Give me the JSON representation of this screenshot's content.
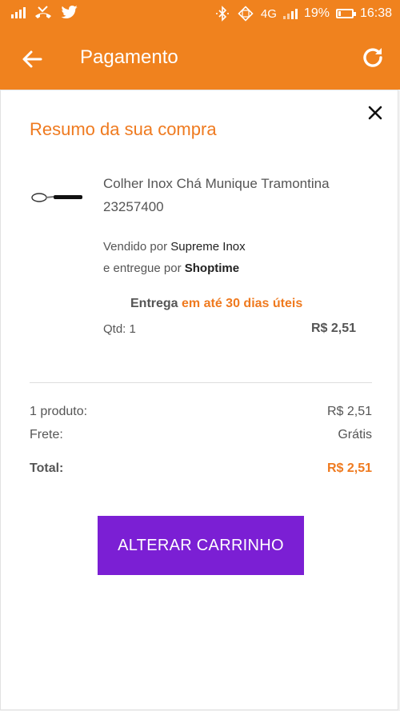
{
  "status_bar": {
    "battery_percent": "19%",
    "network": "4G",
    "time": "16:38",
    "battery_level": 0.19
  },
  "app_bar": {
    "title": "Pagamento",
    "background_color": "#f0821e"
  },
  "summary": {
    "title": "Resumo da sua compra",
    "product": {
      "name": "Colher Inox Chá Munique Tramontina 23257400",
      "sold_by_label": "Vendido por",
      "seller": "Supreme Inox",
      "delivered_by_label": "e entregue por",
      "deliverer": "Shoptime",
      "delivery_label": "Entrega",
      "delivery_time": "em até 30 dias úteis",
      "qty_label": "Qtd: 1",
      "price": "R$ 2,51"
    },
    "totals": {
      "products_label": "1 produto:",
      "products_value": "R$ 2,51",
      "shipping_label": "Frete:",
      "shipping_value": "Grátis",
      "total_label": "Total:",
      "total_value": "R$ 2,51"
    },
    "button": {
      "label": "ALTERAR CARRINHO",
      "color": "#7b1fd4"
    },
    "accent_color": "#ef7a1f"
  }
}
